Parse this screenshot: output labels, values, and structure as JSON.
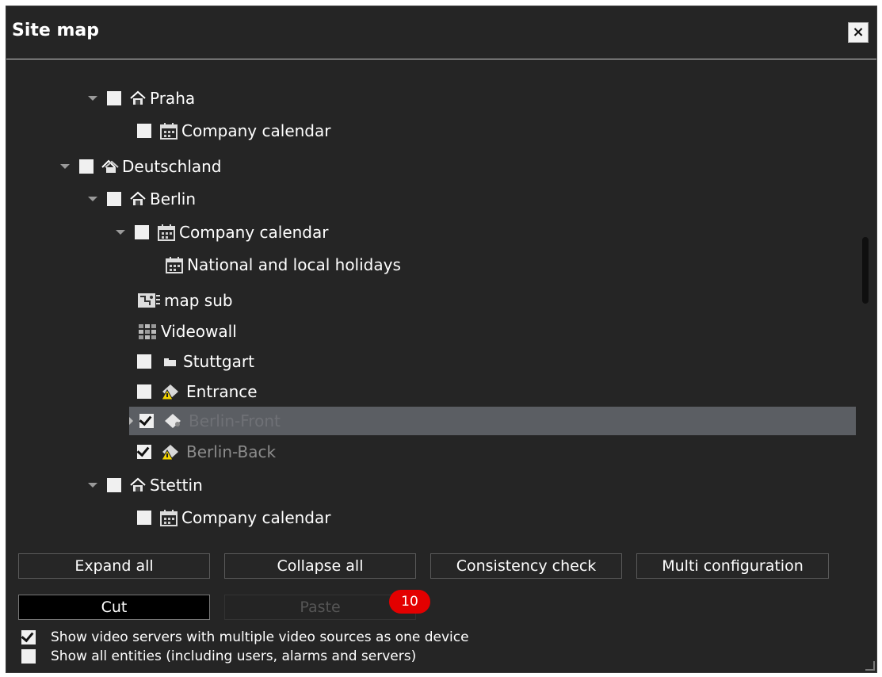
{
  "window": {
    "title": "Site map",
    "close_label": "×"
  },
  "tree": {
    "praha": "Praha",
    "praha_calendar": "Company calendar",
    "deutschland": "Deutschland",
    "berlin": "Berlin",
    "berlin_calendar": "Company calendar",
    "holidays": "National and local holidays",
    "map_sub": "map sub",
    "videowall": "Videowall",
    "stuttgart": "Stuttgart",
    "entrance": "Entrance",
    "berlin_front": "Berlin-Front",
    "berlin_back": "Berlin-Back",
    "stettin": "Stettin",
    "stettin_calendar": "Company calendar"
  },
  "buttons": {
    "expand_all": "Expand all",
    "collapse_all": "Collapse all",
    "consistency_check": "Consistency check",
    "multi_configuration": "Multi configuration",
    "cut": "Cut",
    "paste": "Paste"
  },
  "badge": "10",
  "options": {
    "show_video_servers": "Show video servers with multiple video sources as one device",
    "show_video_servers_checked": true,
    "show_all_entities": "Show all entities (including users, alarms and servers)",
    "show_all_entities_checked": false
  },
  "colors": {
    "background": "#252525",
    "selected_row": "#5b5e63",
    "badge": "#e30000"
  }
}
